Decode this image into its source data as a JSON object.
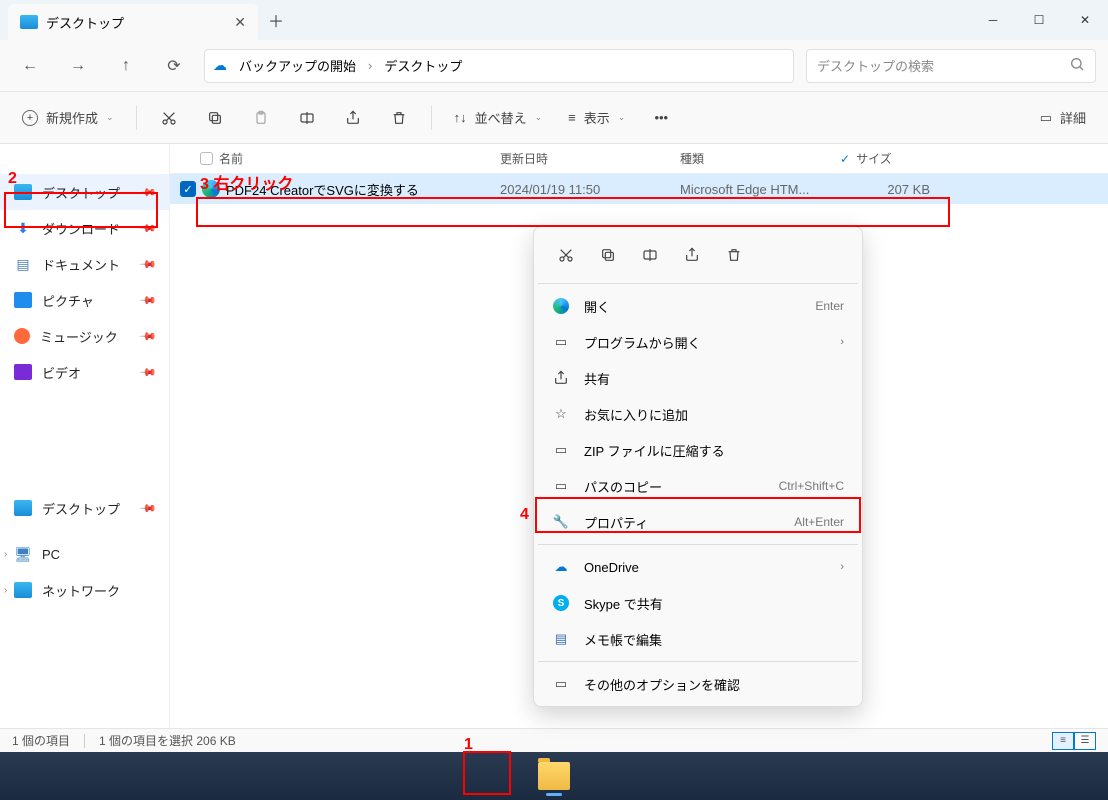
{
  "window": {
    "tab_title": "デスクトップ"
  },
  "breadcrumb": {
    "backup_label": "バックアップの開始",
    "location": "デスクトップ"
  },
  "search": {
    "placeholder": "デスクトップの検索"
  },
  "toolbar": {
    "new_label": "新規作成",
    "sort_label": "並べ替え",
    "view_label": "表示",
    "details_label": "詳細"
  },
  "sidebar": {
    "items": [
      {
        "label": "デスクトップ",
        "icon": "desktop"
      },
      {
        "label": "ダウンロード",
        "icon": "download"
      },
      {
        "label": "ドキュメント",
        "icon": "document"
      },
      {
        "label": "ピクチャ",
        "icon": "picture"
      },
      {
        "label": "ミュージック",
        "icon": "music"
      },
      {
        "label": "ビデオ",
        "icon": "video"
      }
    ],
    "desktop2": "デスクトップ",
    "pc": "PC",
    "network": "ネットワーク"
  },
  "columns": {
    "name": "名前",
    "date": "更新日時",
    "type": "種類",
    "size": "サイズ"
  },
  "file": {
    "name": "PDF24 CreatorでSVGに変換する",
    "date": "2024/01/19 11:50",
    "type": "Microsoft Edge HTM...",
    "size": "207 KB"
  },
  "context_menu": {
    "open": "開く",
    "open_shortcut": "Enter",
    "open_with": "プログラムから開く",
    "share": "共有",
    "favorite": "お気に入りに追加",
    "zip": "ZIP ファイルに圧縮する",
    "copy_path": "パスのコピー",
    "copy_path_shortcut": "Ctrl+Shift+C",
    "properties": "プロパティ",
    "properties_shortcut": "Alt+Enter",
    "onedrive": "OneDrive",
    "skype": "Skype で共有",
    "notepad": "メモ帳で編集",
    "more_options": "その他のオプションを確認"
  },
  "statusbar": {
    "count": "1 個の項目",
    "selected": "1 個の項目を選択 206 KB"
  },
  "annotations": {
    "n1": "1",
    "n2": "2",
    "n3": "3 右クリック",
    "n4": "4"
  }
}
